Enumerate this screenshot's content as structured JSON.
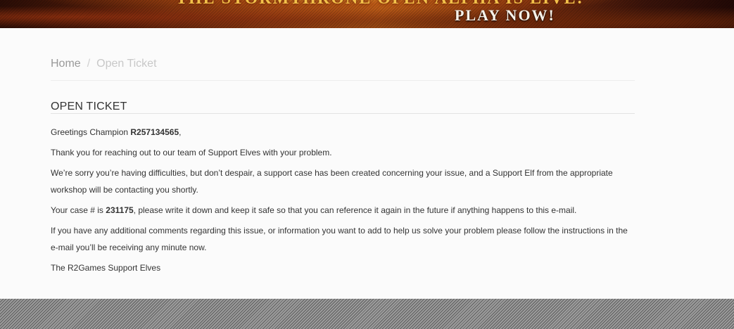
{
  "banner": {
    "headline": "THE STORMTHRONE OPEN ALPHA IS LIVE!",
    "cta": "PLAY NOW!"
  },
  "breadcrumb": {
    "home": "Home",
    "separator": "/",
    "current": "Open Ticket"
  },
  "page": {
    "title": "OPEN TICKET"
  },
  "message": {
    "greeting_prefix": "Greetings Champion ",
    "champion_id": "R257134565",
    "greeting_suffix": ",",
    "thanks": "Thank you for reaching out to our team of Support Elves with your problem.",
    "sorry": "We’re sorry you’re having difficulties, but don’t despair, a support case has been created concerning your issue, and a Support Elf from the appropriate workshop will be contacting you shortly.",
    "case_prefix": "Your case # is ",
    "case_number": "231175",
    "case_suffix": ", please write it down and keep it safe so that you can reference it again in the future if anything happens to this e-mail.",
    "additional": "If you have any additional comments regarding this issue, or information you want to add to help us solve your problem please follow the instructions in the e-mail you’ll be receiving any minute now.",
    "signature": "The R2Games Support Elves"
  }
}
